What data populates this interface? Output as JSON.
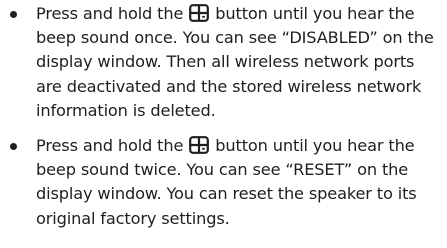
{
  "items": [
    {
      "before": "Press and hold the",
      "icon": "wireless-connect-icon",
      "after": "button until you hear the beep sound once. You can see “DISABLED” on the display window. Then all wireless network ports are deactivated and the stored wireless network information is deleted."
    },
    {
      "before": "Press and hold the",
      "icon": "wireless-connect-icon",
      "after": "button until you hear the beep sound twice. You can see “RESET” on the display window. You can reset the speaker to its original factory settings."
    }
  ]
}
